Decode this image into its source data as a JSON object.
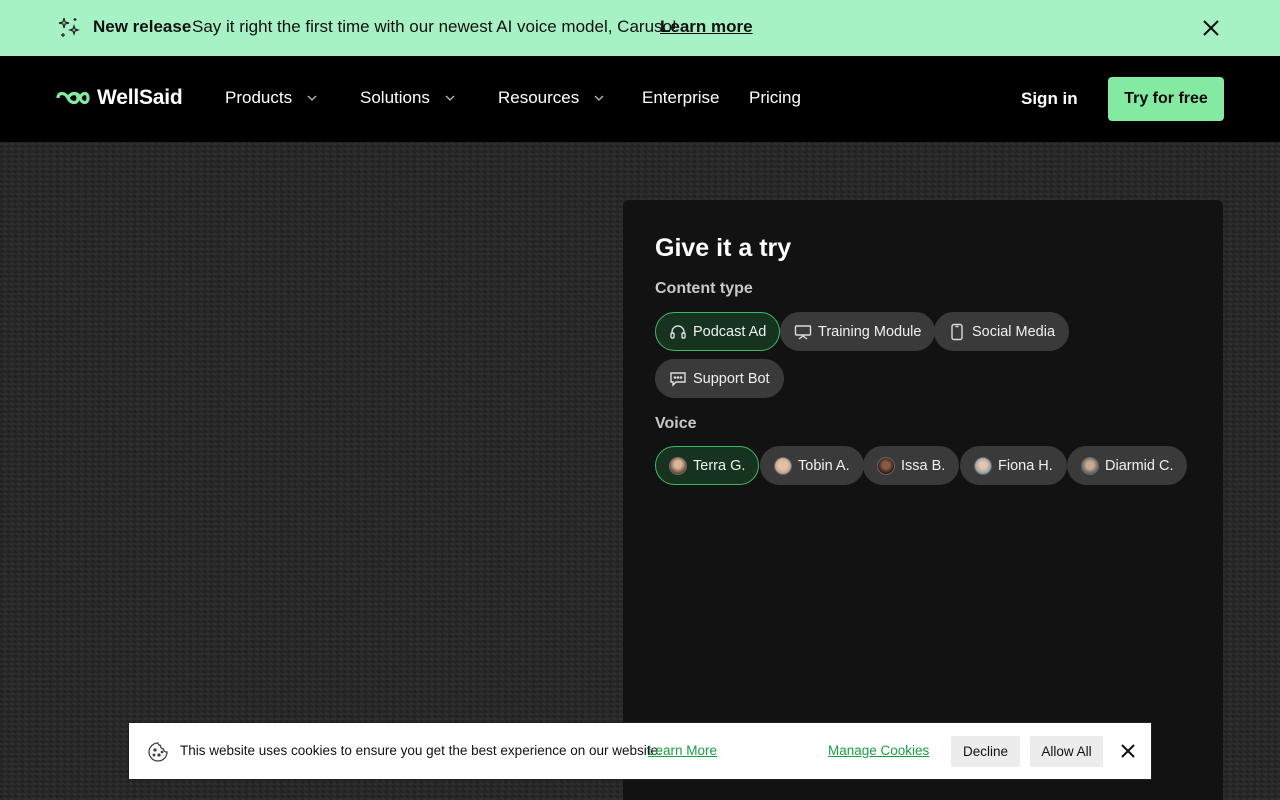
{
  "announcement": {
    "tag": "New release",
    "message": "Say it right the first time with our newest AI voice model, Caruso!",
    "link": "Learn more",
    "icon": "sparkle-icon",
    "close_icon": "close-icon"
  },
  "nav": {
    "brand": "WellSaid",
    "items": [
      {
        "label": "Products",
        "has_dropdown": true
      },
      {
        "label": "Solutions",
        "has_dropdown": true
      },
      {
        "label": "Resources",
        "has_dropdown": true
      },
      {
        "label": "Enterprise",
        "has_dropdown": false
      },
      {
        "label": "Pricing",
        "has_dropdown": false
      }
    ],
    "sign_in": "Sign in",
    "cta": "Try for free"
  },
  "panel": {
    "title": "Give it a try",
    "content_type_label": "Content type",
    "content_types": [
      {
        "label": "Podcast Ad",
        "icon": "headphones-icon",
        "selected": true
      },
      {
        "label": "Training Module",
        "icon": "presentation-icon",
        "selected": false
      },
      {
        "label": "Social Media",
        "icon": "phone-icon",
        "selected": false
      },
      {
        "label": "Support Bot",
        "icon": "chat-bubble-icon",
        "selected": false
      }
    ],
    "voice_label": "Voice",
    "voices": [
      {
        "label": "Terra G.",
        "selected": true
      },
      {
        "label": "Tobin A.",
        "selected": false
      },
      {
        "label": "Issa B.",
        "selected": false
      },
      {
        "label": "Fiona H.",
        "selected": false
      },
      {
        "label": "Diarmid C.",
        "selected": false
      }
    ]
  },
  "cookie": {
    "text": "This website uses cookies to ensure you get the best experience on our website.",
    "learn_more": "Learn More",
    "manage": "Manage Cookies",
    "decline": "Decline",
    "allow_all": "Allow All",
    "icon": "cookie-icon"
  },
  "colors": {
    "announcement_bg": "#a6f2c4",
    "cta_bg": "#84eaa1",
    "selected_border": "#3fb863",
    "link_green": "#1a9c46"
  }
}
